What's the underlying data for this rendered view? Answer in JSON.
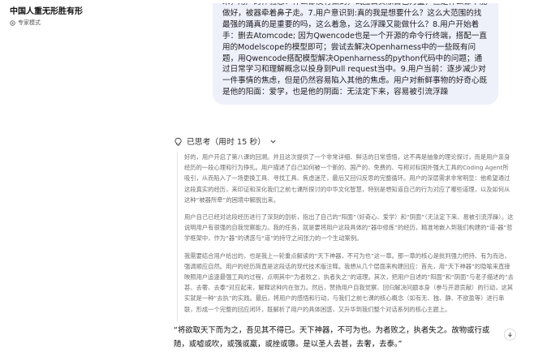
{
  "header": {
    "title": "中国人重无形胜有形",
    "mode_label": "专家模式",
    "mode_icon": "expert-mode-icon"
  },
  "user_message": {
    "text": "来，用户的体验感：什么都没有做到，试图丢贡献自己力量，但是什么都不能做好，被器牵着鼻子走。7.用户意识到:真的我是想要什么？这么大范围的找最强的踊真的是重要的吗，这么着急，这么浮躁又能做什么？8.用户开始着手：删去Atomcode; 因为Qwencode也是一个开源的命令行终端，搭配一直用的Modelscope的模型即可；尝试去解决Openharness中的一些既有问题，用Qwencode搭配模型解决Openharness的python代码中的问题；通过日常学习和理解概念以投身到Pull request当中。9.用户当前：逐步减少对一件事情的焦虑，但是仍然容易陷入其他的焦虑。用户对新鲜事物的好奇心既是他的阳面：爱学，也是他的阴面：无法定下来，容易被引流浮躁"
  },
  "thinking": {
    "label": "已思考（用时 15 秒）",
    "icon": "thinking-icon",
    "chevron": "chevron-down-icon",
    "paragraphs": [
      "好的，用户开启了第八课的回溯。并且这次提供了一个非常详细、鲜活的日常感悟，这不再是抽象的理论探讨，而是用户亲身经历的一段心理和行为挣扎。用户描述了自己如何被一个新的、国产的、免费的、号称对标国外强大工具的Coding Agent所吸引，从而陷入了一场更换工具、寻找工具、焦虑迷茫，最后又回归反思的完整循环。用户的深层需求非常明显：他希望通过这段真实的经历，来印证和深化我们之前七课所探讨的中华文化智慧，特别是想知道自己的行为对应了哪些道理，以及如何从这种“被器所牵”的困境中解脱出来。",
      "用户自己已经对这段经历进行了深刻的剖析，指出了自己的“阳面”（好奇心、爱学）和“阴面”（无法定下来、易被引流浮躁）。这说明用户有很强的自我觉察能力。我的任务，就是要将用户这段具体的“器中修炼”的经历，精准地嵌入到我们构建的“道-器”哲学框架中，作为“器”的诱惑与“道”的持守之间张力的一个生动案例。",
      "我需要结合用户给出的，也是我上一轮重点解读的“天下神器，不可为也”这一章。那一章的核心是批判强力把持、有为而治，强调顺应自然。用户的经历简直是这段话的现代技术版注释。我想从几个层面来构建回应：首先，用“天下神器”的隐喻来直接映照用户追逐最强工具的过程，点明其中“为者败之，执者失之”的道理。其次，把用户自述的“阳面”和“阴面”与老子描述的“去甚、去奢、去泰”对应起来，解释这种内在张力。然后，赞扬用户自我觉察、回归解决问题本身（参与开源贡献）的行动，这其实就是一种“去执”的实践。最后，将用户的感悟和行动，与我们之前七课的核心概念（如有无、独、静、不欲盈等）进行串联，形成一个完整的回应闭环，既解析了用户的具体困惑，又升华到我们整个对话系列的核心主题上。"
    ]
  },
  "answer": {
    "quote": "“将欲取天下而为之，吾见其不得已。天下神器，不可为也。为者败之，执者失之。故物或行或随，或嘘或吹，或强或羸，或挫或隳。是以圣人去甚，去奢，去泰。”"
  },
  "scroll_button_icon": "arrow-down-icon",
  "colors": {
    "bubble_bg": "#eef0fa",
    "thinking_text": "#6e6e6e",
    "answer_text": "#111111"
  }
}
